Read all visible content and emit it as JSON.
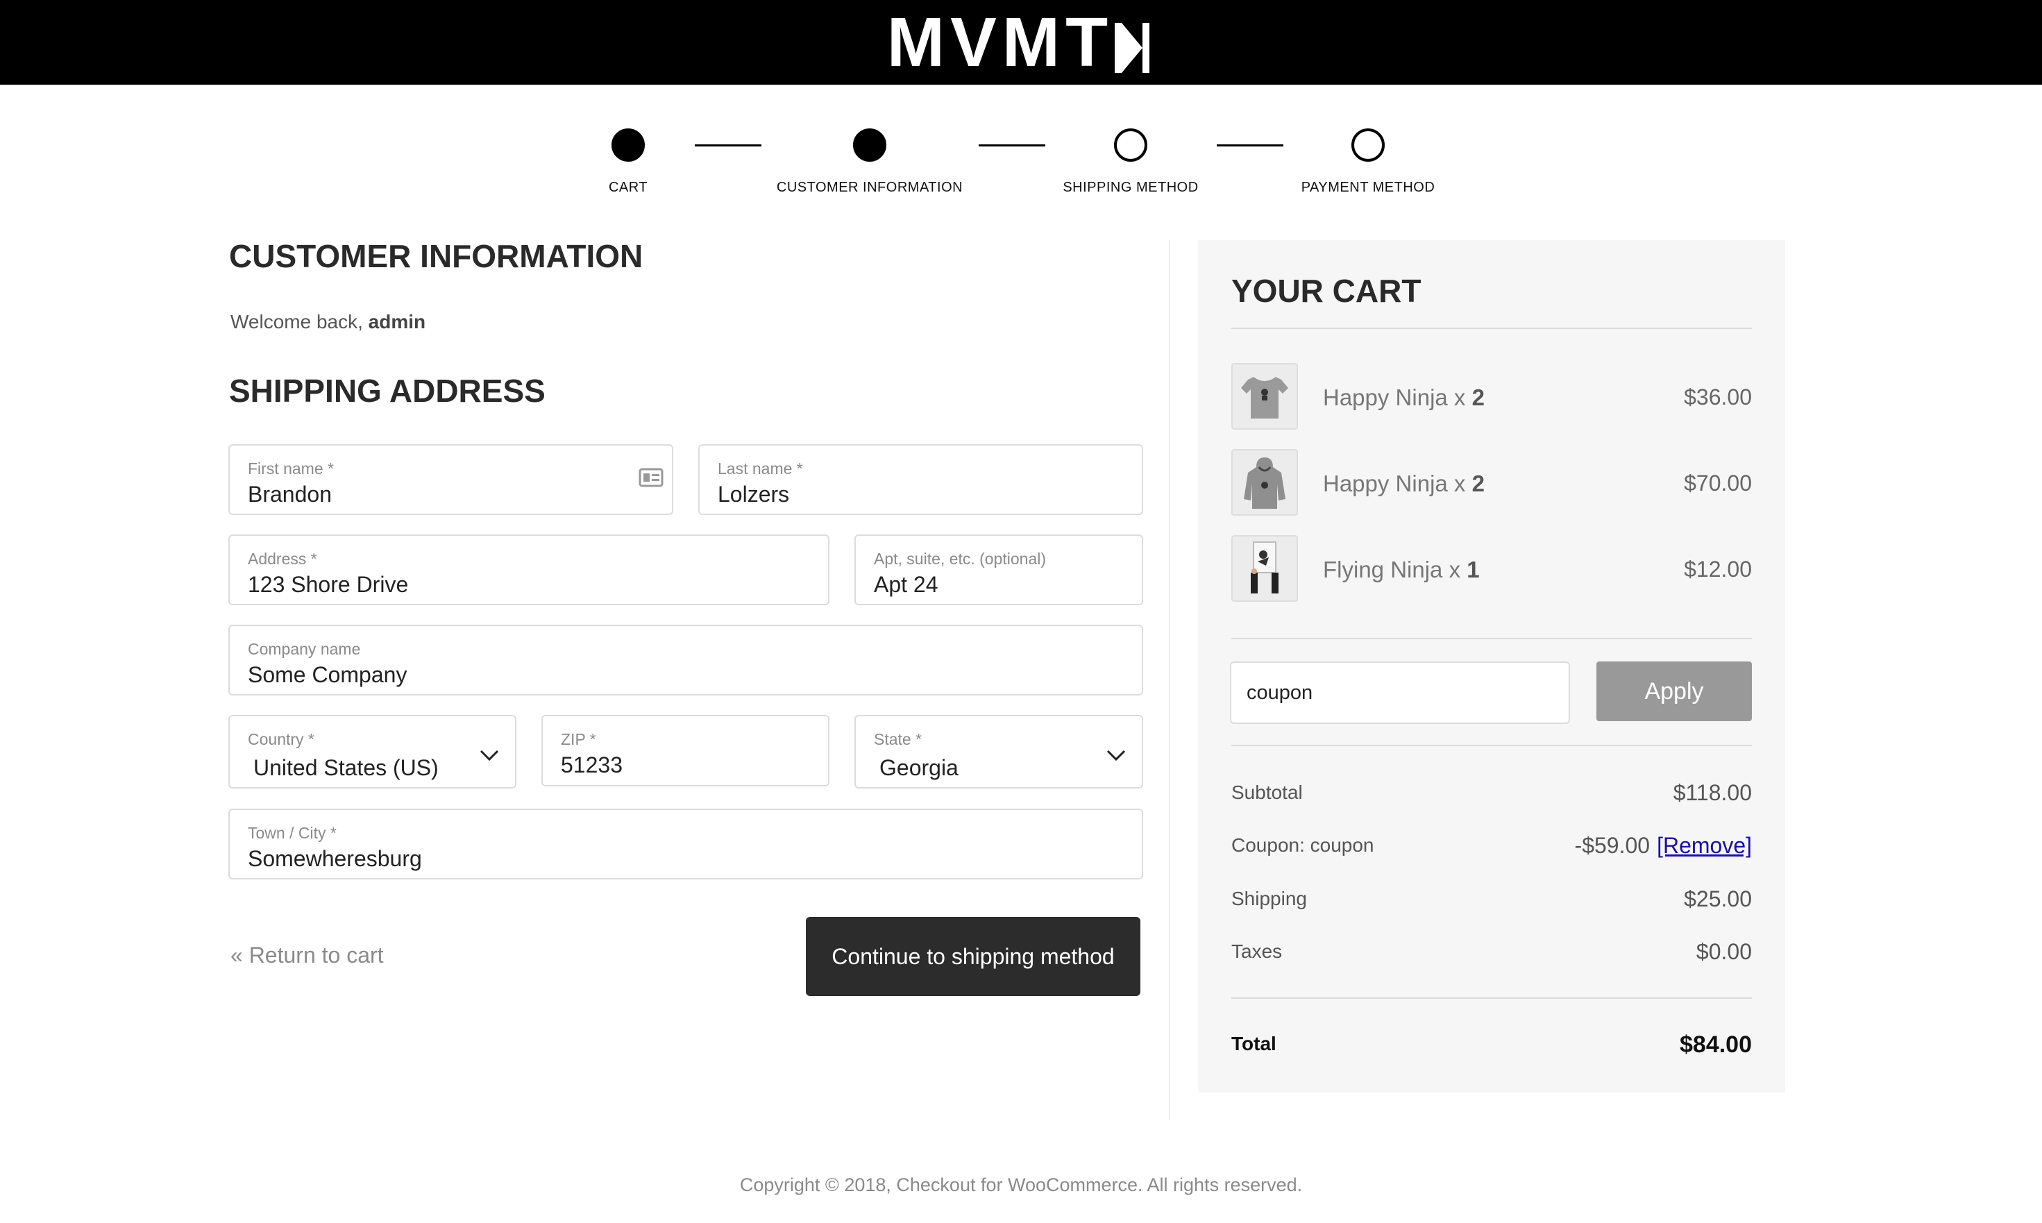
{
  "brand": {
    "logo_text": "MVMT"
  },
  "steps": [
    {
      "label": "CART",
      "state": "done"
    },
    {
      "label": "CUSTOMER INFORMATION",
      "state": "done"
    },
    {
      "label": "SHIPPING METHOD",
      "state": "todo"
    },
    {
      "label": "PAYMENT METHOD",
      "state": "todo"
    }
  ],
  "customer": {
    "heading": "CUSTOMER INFORMATION",
    "welcome_prefix": "Welcome back, ",
    "username": "admin"
  },
  "shipping": {
    "heading": "SHIPPING ADDRESS",
    "first_name": {
      "label": "First name *",
      "value": "Brandon"
    },
    "last_name": {
      "label": "Last name *",
      "value": "Lolzers"
    },
    "address": {
      "label": "Address *",
      "value": "123 Shore Drive"
    },
    "apt": {
      "label": "Apt, suite, etc. (optional)",
      "value": "Apt 24"
    },
    "company": {
      "label": "Company name",
      "value": "Some Company"
    },
    "country": {
      "label": "Country *",
      "value": "United States (US)"
    },
    "zip": {
      "label": "ZIP *",
      "value": "51233"
    },
    "state": {
      "label": "State *",
      "value": "Georgia"
    },
    "city": {
      "label": "Town / City *",
      "value": "Somewheresburg"
    }
  },
  "actions": {
    "return_label": "« Return to cart",
    "continue_label": "Continue to shipping method"
  },
  "cart": {
    "heading": "YOUR CART",
    "items": [
      {
        "name": "Happy Ninja",
        "sep": " x ",
        "qty": "2",
        "price": "$36.00",
        "icon": "tshirt-thumbnail"
      },
      {
        "name": "Happy Ninja",
        "sep": " x ",
        "qty": "2",
        "price": "$70.00",
        "icon": "hoodie-thumbnail"
      },
      {
        "name": "Flying Ninja",
        "sep": " x ",
        "qty": "1",
        "price": "$12.00",
        "icon": "poster-thumbnail"
      }
    ],
    "coupon_value": "coupon",
    "apply_label": "Apply",
    "subtotal_label": "Subtotal",
    "subtotal_value": "$118.00",
    "coupon_label": "Coupon: coupon",
    "coupon_amount": "-$59.00",
    "remove_label": "[Remove]",
    "shipping_label": "Shipping",
    "shipping_value": "$25.00",
    "taxes_label": "Taxes",
    "taxes_value": "$0.00",
    "total_label": "Total",
    "total_value": "$84.00"
  },
  "footer": {
    "text": "Copyright © 2018, Checkout for WooCommerce. All rights reserved."
  },
  "colors": {
    "header_bg": "#000000",
    "button_dark": "#2c2c2c",
    "apply_button": "#999999",
    "link_blue": "#1a0dab",
    "panel_bg": "#f6f6f6"
  }
}
